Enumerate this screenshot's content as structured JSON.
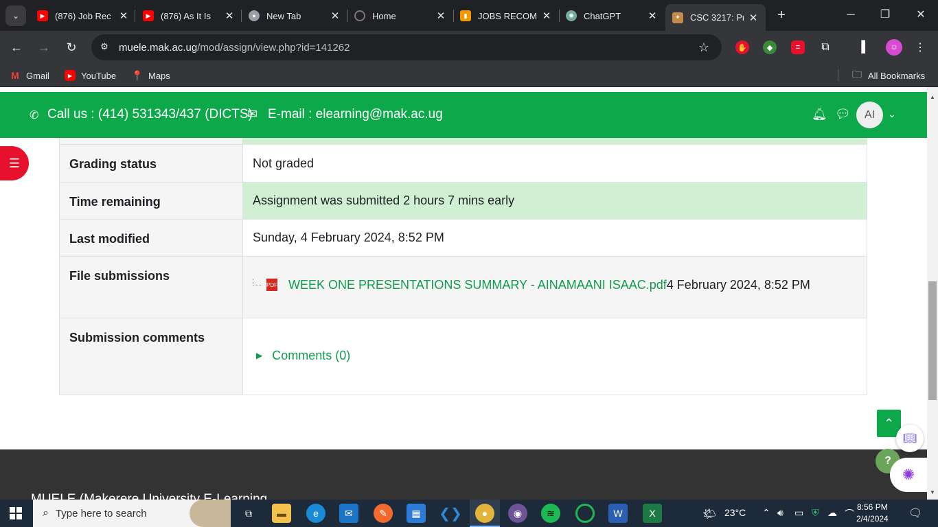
{
  "browser": {
    "tabs": [
      {
        "title": "(876) Job Rec",
        "favicon": "youtube-icon",
        "color": "#ff0000"
      },
      {
        "title": "(876) As It Is",
        "favicon": "youtube-icon",
        "color": "#ff0000"
      },
      {
        "title": "New Tab",
        "favicon": "chrome-icon",
        "color": "#9aa0a6"
      },
      {
        "title": "Home",
        "favicon": "circle-icon",
        "color": "#7a7a7a"
      },
      {
        "title": "JOBS RECOM",
        "favicon": "book-icon",
        "color": "#f29900"
      },
      {
        "title": "ChatGPT",
        "favicon": "chatgpt-icon",
        "color": "#74aa9c"
      },
      {
        "title": "CSC 3217: Pr",
        "favicon": "muele-icon",
        "color": "#c58b4b"
      }
    ],
    "url_host": "muele.mak.ac.ug",
    "url_path": "/mod/assign/view.php?id=141262",
    "bookmarks": [
      {
        "label": "Gmail",
        "icon": "gmail-icon"
      },
      {
        "label": "YouTube",
        "icon": "youtube-icon"
      },
      {
        "label": "Maps",
        "icon": "maps-icon"
      }
    ],
    "all_bookmarks": "All Bookmarks"
  },
  "header": {
    "call": "Call us : (414) 531343/437 (DICTS)",
    "email": "E-mail : elearning@mak.ac.ug",
    "avatar_initials": "AI"
  },
  "submission": {
    "rows": [
      {
        "label": "Grading status",
        "value": "Not graded"
      },
      {
        "label": "Time remaining",
        "value": "Assignment was submitted 2 hours 7 mins early"
      },
      {
        "label": "Last modified",
        "value": "Sunday, 4 February 2024, 8:52 PM"
      },
      {
        "label": "File submissions",
        "file_name": "WEEK ONE PRESENTATIONS SUMMARY - AINAMAANI ISAAC.pdf",
        "file_date": "4 February 2024, 8:52 PM"
      },
      {
        "label": "Submission comments",
        "comments": "Comments (0)"
      }
    ]
  },
  "footer": {
    "title": "MUELE (Makerere University E-Learning"
  },
  "taskbar": {
    "search_placeholder": "Type here to search",
    "weather": "23°C",
    "time": "8:56 PM",
    "date": "2/4/2024"
  }
}
